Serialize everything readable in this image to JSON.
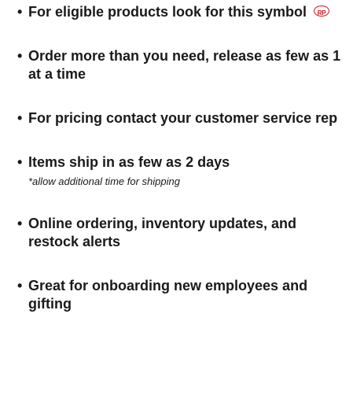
{
  "bullet_char": "•",
  "rp_symbol": {
    "text": "RP",
    "color": "#d0101a"
  },
  "items": [
    {
      "text": "For eligible products look for this symbol"
    },
    {
      "text": "Order more than you need, release as few as 1 at a time"
    },
    {
      "text": "For pricing contact your customer service rep"
    },
    {
      "text": "Items ship in as few as 2 days",
      "note": "*allow additional time for shipping"
    },
    {
      "text": "Online ordering, inventory updates, and restock alerts"
    },
    {
      "text": "Great for onboarding new employees and gifting"
    }
  ]
}
